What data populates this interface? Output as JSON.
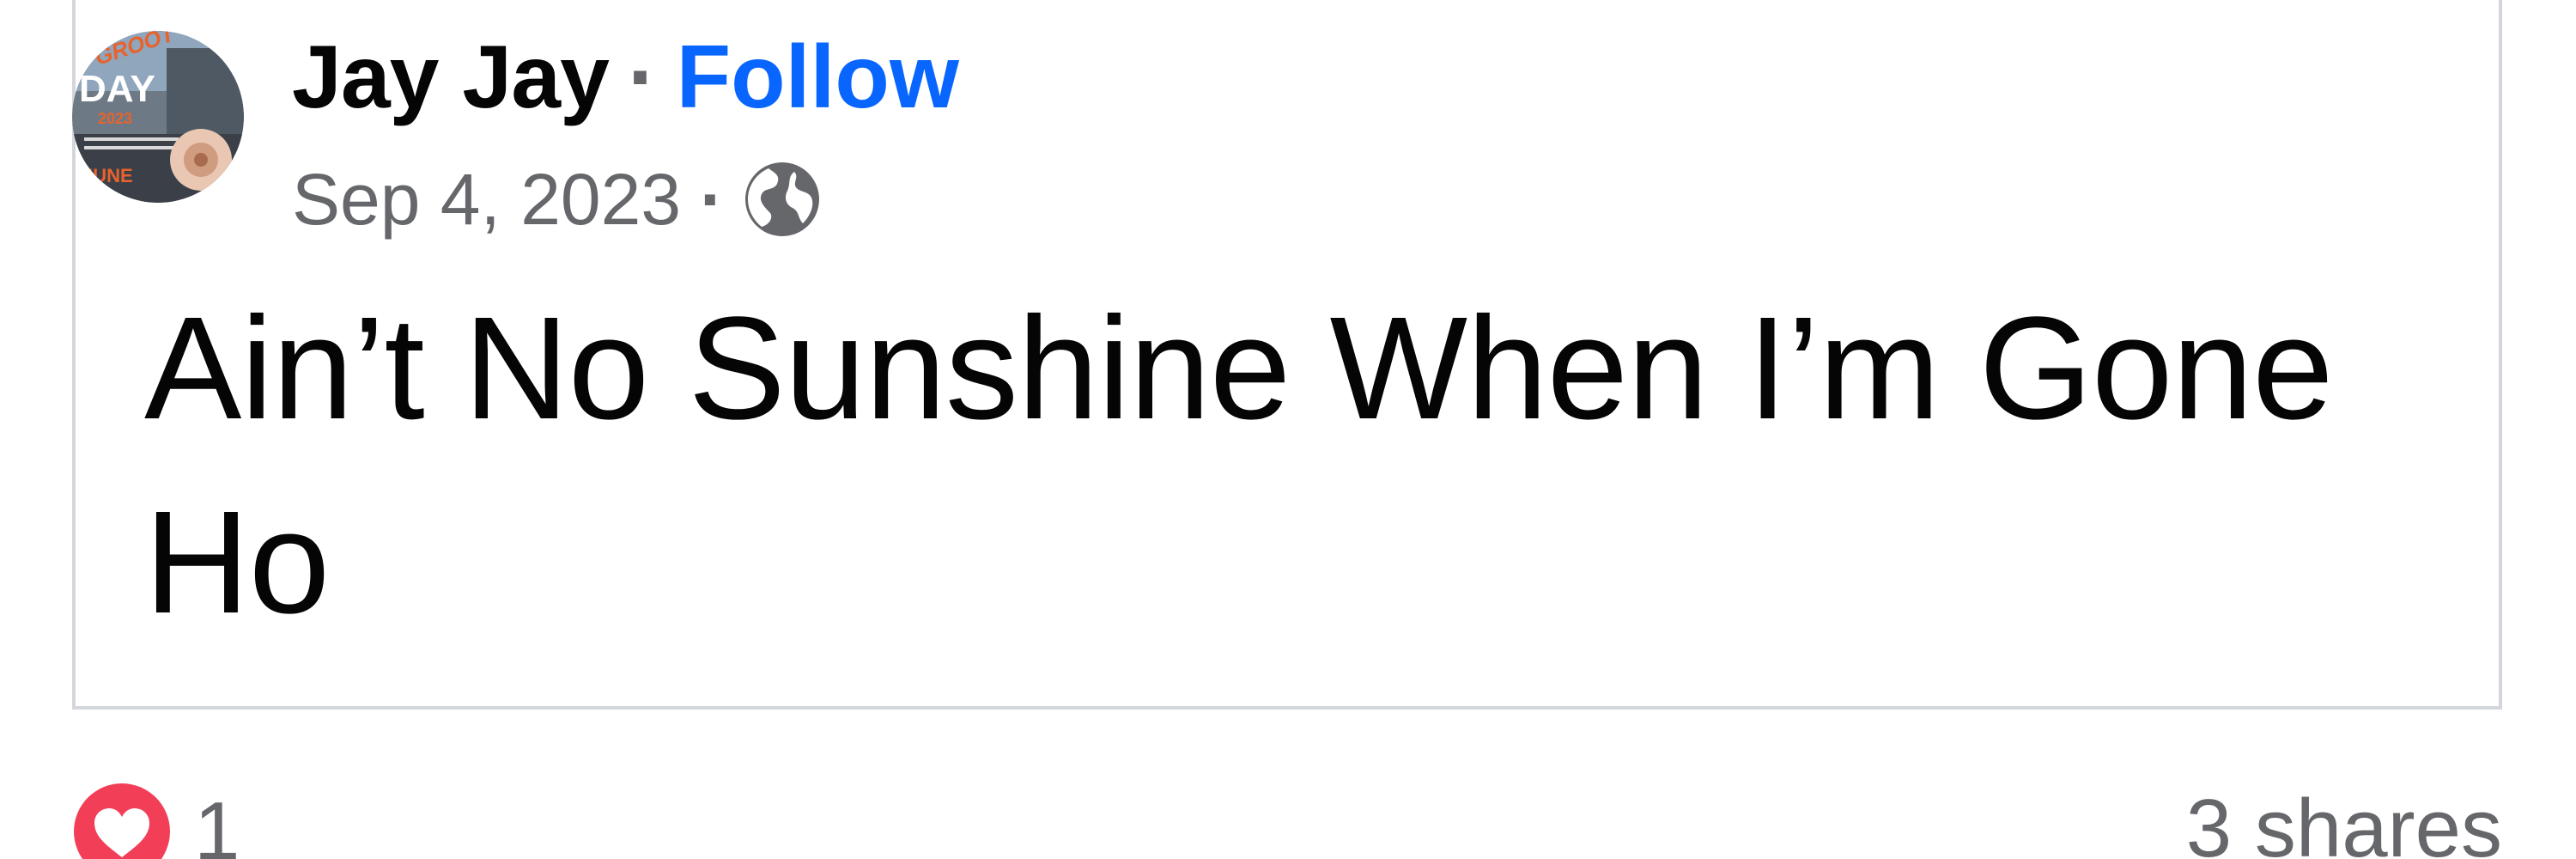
{
  "post": {
    "author": "Jay Jay",
    "separator": "·",
    "follow_label": "Follow",
    "date": "Sep 4, 2023",
    "meta_separator": "·",
    "audience_icon": "globe-icon",
    "text": "Ain’t No Sunshine When I’m Gone Ho",
    "avatar": {
      "icon": "profile-avatar",
      "lettering": [
        "GROOT",
        "DAY",
        "2023"
      ]
    }
  },
  "reactions": {
    "icon": "love-reaction-icon",
    "count": "1",
    "shares": "3 shares"
  },
  "colors": {
    "follow_blue": "#0866ff",
    "secondary_text": "#65676b",
    "primary_text": "#050505",
    "love_red": "#f33e58",
    "card_border": "#d3d6db"
  }
}
